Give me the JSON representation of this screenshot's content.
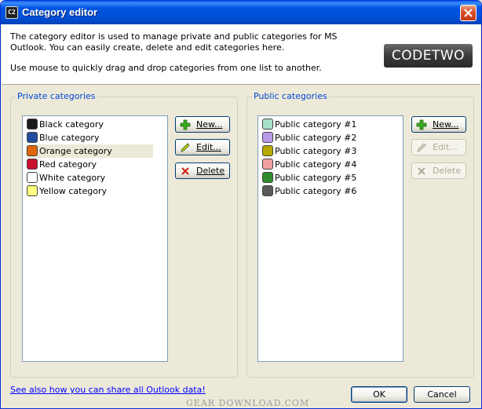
{
  "window": {
    "title": "Category editor",
    "app_icon_text": "C2"
  },
  "header": {
    "description": "The category editor is used to manage private and public categories for MS Outlook. You can easily create, delete and edit categories here.",
    "hint": "Use mouse to quickly drag and drop categories from one list to another.",
    "logo_text": "CODETWO"
  },
  "private": {
    "title": "Private categories",
    "items": [
      {
        "label": "Black category",
        "color": "#1a1a1a",
        "selected": false
      },
      {
        "label": "Blue category",
        "color": "#1f4e9e",
        "selected": false
      },
      {
        "label": "Orange category",
        "color": "#e0660c",
        "selected": true
      },
      {
        "label": "Red category",
        "color": "#c8102e",
        "selected": false
      },
      {
        "label": "White category",
        "color": "#ffffff",
        "selected": false
      },
      {
        "label": "Yellow category",
        "color": "#ffff80",
        "selected": false
      }
    ],
    "buttons": {
      "new": "New...",
      "edit": "Edit...",
      "delete": "Delete"
    }
  },
  "public": {
    "title": "Public categories",
    "items": [
      {
        "label": "Public category #1",
        "color": "#a8e0c8"
      },
      {
        "label": "Public category #2",
        "color": "#b89ae8"
      },
      {
        "label": "Public category #3",
        "color": "#b8a800"
      },
      {
        "label": "Public category #4",
        "color": "#f0a0a0"
      },
      {
        "label": "Public category #5",
        "color": "#2e8b2e"
      },
      {
        "label": "Public category #6",
        "color": "#5a5a5a"
      }
    ],
    "buttons": {
      "new": "New...",
      "edit": "Edit...",
      "delete": "Delete"
    }
  },
  "footer": {
    "share_link": "See also how you can share all Outlook data!",
    "ok": "OK",
    "cancel": "Cancel",
    "watermark": "GEAR DOWNLOAD.COM"
  }
}
